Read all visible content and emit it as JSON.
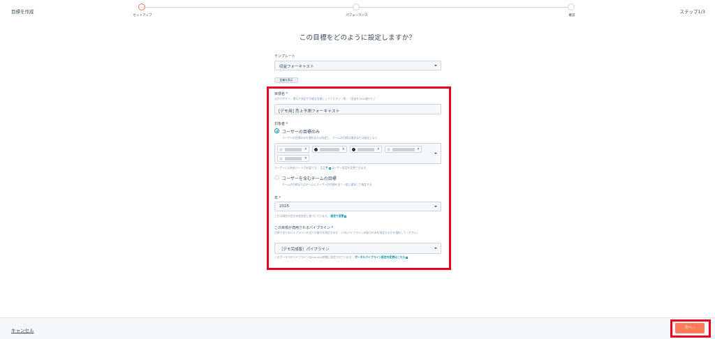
{
  "header": {
    "app_title": "目標を作成",
    "step_counter": "ステップ1/3",
    "steps": [
      {
        "label": "セットアップ",
        "active": true
      },
      {
        "label": "パフォーマンス",
        "active": false
      },
      {
        "label": "確認",
        "active": false
      }
    ]
  },
  "page": {
    "heading": "この目標をどのように設定しますか？"
  },
  "template": {
    "label": "テンプレート",
    "value": "収益フォーキャスト",
    "definition_button": "定義を表示"
  },
  "goal_name": {
    "label": "目標名 *",
    "helper": "分かりやすく、実行や測定が可能な目標にしてください（例：「収益を10%増やす」）",
    "value": "[デモ用] 売上予測フォーキャスト"
  },
  "assignee": {
    "label": "対象者 *",
    "option_users": {
      "label": "ユーザーの目標のみ",
      "desc": "ユーザーの目標のみを選択または指定し、チームの目標は選択または指定しない",
      "checked": true
    },
    "tags_count": 5,
    "seat_note": "ユーザーには有料シートが必要です。",
    "seat_link": "ここで",
    "seat_note_tail": "ユーザー設定を変更できます。",
    "option_teams": {
      "label": "ユーザーを含むチームの目標",
      "desc": "チームの目標またはチームとユーザーの目標を全て一度に選択して指定する",
      "checked": false
    }
  },
  "year": {
    "label": "年 *",
    "value": "2025",
    "helper": "これは現在の会計年度設定に基づいています。",
    "helper_link": "設定で変更"
  },
  "pipeline": {
    "label": "この目標が適用されるパイプライン *",
    "helper": "目標で全てのパイプラインの全ての取引を測定するか、1つのパイプラインの取引のみを測定するかを選択してください。",
    "value": "［デモ完成版］パイプライン",
    "note": "このポータルのパイプラインはmonthly期間に設定されています。",
    "note_link": "ポータルパイプライン設定の変更はこちら"
  },
  "footer": {
    "cancel": "キャンセル",
    "next": "次へ ›"
  }
}
